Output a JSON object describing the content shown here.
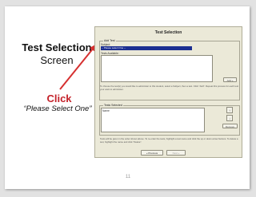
{
  "slide": {
    "title": "Test Selection",
    "subtitle": "Screen",
    "click_label": "Click",
    "instruction": "“Please Select One”",
    "page_number": "11"
  },
  "window": {
    "title": "Test Selection",
    "add_test": {
      "legend": "Add Test",
      "subject_label": "Subject:",
      "subject_value": "-- Please select One --",
      "tests_label": "Tests Available:",
      "add_button": "Add »",
      "instructions": "To choose the test(s) you would like to administer to this student, select a Subject, then a test. Click \"Add\". Repeat this process for each test your want to administer."
    },
    "tests_selected": {
      "legend": "Tests Selected",
      "column_name": "Name",
      "up_icon": "↑",
      "down_icon": "↓",
      "remove_button": "Remove",
      "instructions": "Tests will be given in the order shown above. To re-order the tests, highlight a test name and click the up or down arrow buttons. To delete a test, highlight the name and click \"Delete\"."
    },
    "previous_button": "« Previous",
    "next_button": "Next »"
  }
}
